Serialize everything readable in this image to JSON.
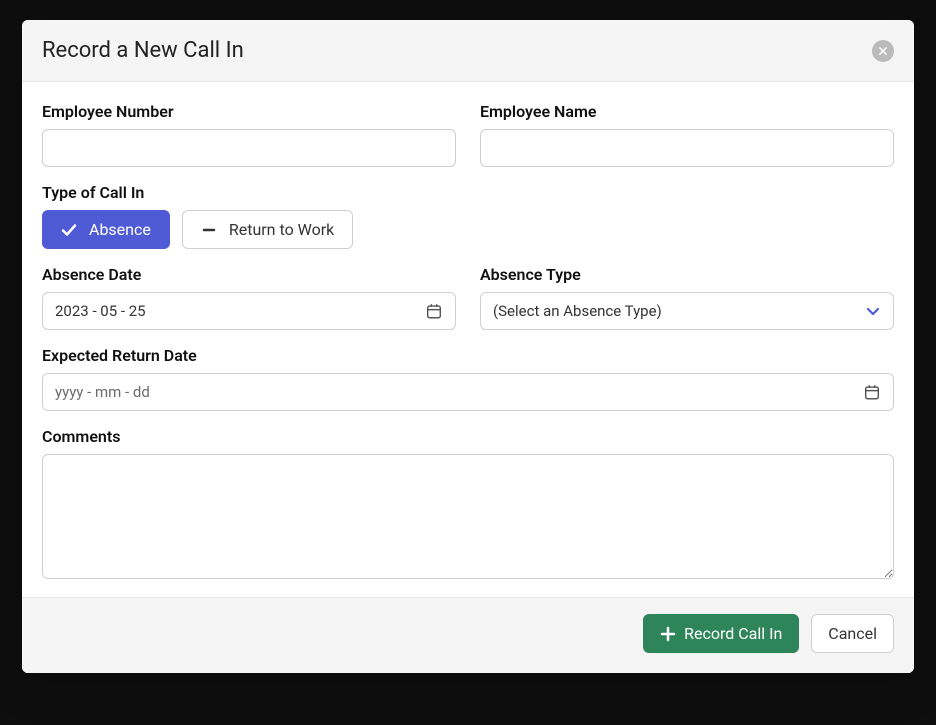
{
  "modal": {
    "title": "Record a New Call In",
    "fields": {
      "employee_number_label": "Employee Number",
      "employee_number_value": "",
      "employee_name_label": "Employee Name",
      "employee_name_value": "",
      "type_of_call_in_label": "Type of Call In",
      "absence_btn": "Absence",
      "return_to_work_btn": "Return to Work",
      "absence_date_label": "Absence Date",
      "absence_date_value": "2023 - 05 - 25",
      "absence_type_label": "Absence Type",
      "absence_type_placeholder": "(Select an Absence Type)",
      "expected_return_label": "Expected Return Date",
      "expected_return_placeholder": "yyyy - mm - dd",
      "comments_label": "Comments",
      "comments_value": ""
    },
    "footer": {
      "record_btn": "Record Call In",
      "cancel_btn": "Cancel"
    }
  },
  "icons": {
    "close": "close-icon",
    "check": "check-icon",
    "dash": "dash-icon",
    "calendar": "calendar-icon",
    "chevron_down": "chevron-down-icon",
    "plus": "plus-icon"
  },
  "colors": {
    "primary_blue": "#4f5bd5",
    "primary_green": "#2f855a",
    "border": "#cfcfcf"
  }
}
